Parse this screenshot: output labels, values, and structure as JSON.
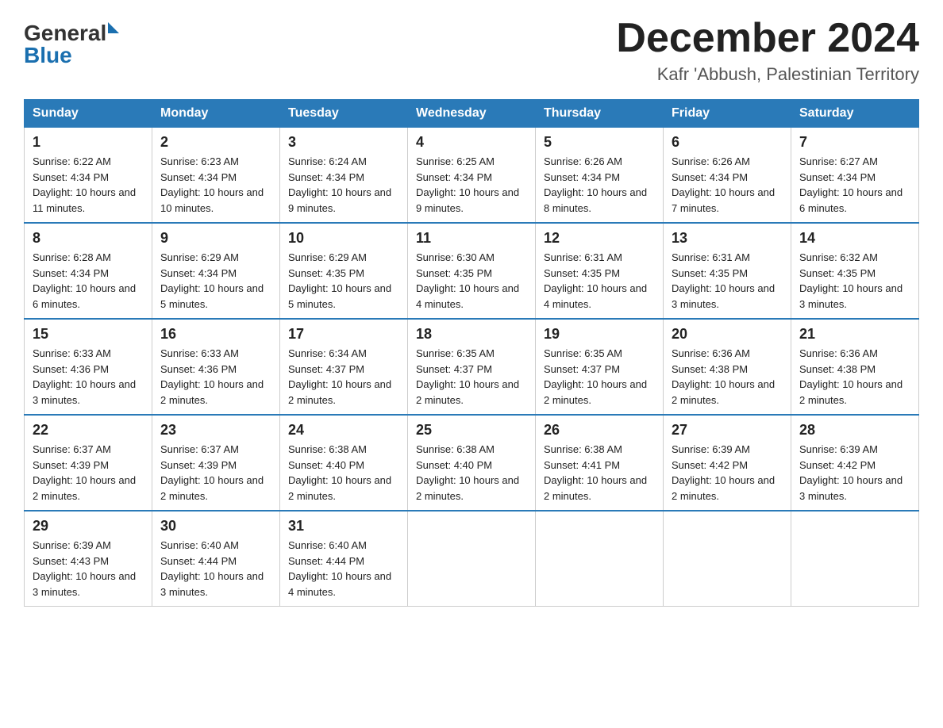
{
  "header": {
    "logo_general": "General",
    "logo_blue": "Blue",
    "month_title": "December 2024",
    "location": "Kafr 'Abbush, Palestinian Territory"
  },
  "days_of_week": [
    "Sunday",
    "Monday",
    "Tuesday",
    "Wednesday",
    "Thursday",
    "Friday",
    "Saturday"
  ],
  "weeks": [
    [
      {
        "day": "1",
        "sunrise": "6:22 AM",
        "sunset": "4:34 PM",
        "daylight": "10 hours and 11 minutes."
      },
      {
        "day": "2",
        "sunrise": "6:23 AM",
        "sunset": "4:34 PM",
        "daylight": "10 hours and 10 minutes."
      },
      {
        "day": "3",
        "sunrise": "6:24 AM",
        "sunset": "4:34 PM",
        "daylight": "10 hours and 9 minutes."
      },
      {
        "day": "4",
        "sunrise": "6:25 AM",
        "sunset": "4:34 PM",
        "daylight": "10 hours and 9 minutes."
      },
      {
        "day": "5",
        "sunrise": "6:26 AM",
        "sunset": "4:34 PM",
        "daylight": "10 hours and 8 minutes."
      },
      {
        "day": "6",
        "sunrise": "6:26 AM",
        "sunset": "4:34 PM",
        "daylight": "10 hours and 7 minutes."
      },
      {
        "day": "7",
        "sunrise": "6:27 AM",
        "sunset": "4:34 PM",
        "daylight": "10 hours and 6 minutes."
      }
    ],
    [
      {
        "day": "8",
        "sunrise": "6:28 AM",
        "sunset": "4:34 PM",
        "daylight": "10 hours and 6 minutes."
      },
      {
        "day": "9",
        "sunrise": "6:29 AM",
        "sunset": "4:34 PM",
        "daylight": "10 hours and 5 minutes."
      },
      {
        "day": "10",
        "sunrise": "6:29 AM",
        "sunset": "4:35 PM",
        "daylight": "10 hours and 5 minutes."
      },
      {
        "day": "11",
        "sunrise": "6:30 AM",
        "sunset": "4:35 PM",
        "daylight": "10 hours and 4 minutes."
      },
      {
        "day": "12",
        "sunrise": "6:31 AM",
        "sunset": "4:35 PM",
        "daylight": "10 hours and 4 minutes."
      },
      {
        "day": "13",
        "sunrise": "6:31 AM",
        "sunset": "4:35 PM",
        "daylight": "10 hours and 3 minutes."
      },
      {
        "day": "14",
        "sunrise": "6:32 AM",
        "sunset": "4:35 PM",
        "daylight": "10 hours and 3 minutes."
      }
    ],
    [
      {
        "day": "15",
        "sunrise": "6:33 AM",
        "sunset": "4:36 PM",
        "daylight": "10 hours and 3 minutes."
      },
      {
        "day": "16",
        "sunrise": "6:33 AM",
        "sunset": "4:36 PM",
        "daylight": "10 hours and 2 minutes."
      },
      {
        "day": "17",
        "sunrise": "6:34 AM",
        "sunset": "4:37 PM",
        "daylight": "10 hours and 2 minutes."
      },
      {
        "day": "18",
        "sunrise": "6:35 AM",
        "sunset": "4:37 PM",
        "daylight": "10 hours and 2 minutes."
      },
      {
        "day": "19",
        "sunrise": "6:35 AM",
        "sunset": "4:37 PM",
        "daylight": "10 hours and 2 minutes."
      },
      {
        "day": "20",
        "sunrise": "6:36 AM",
        "sunset": "4:38 PM",
        "daylight": "10 hours and 2 minutes."
      },
      {
        "day": "21",
        "sunrise": "6:36 AM",
        "sunset": "4:38 PM",
        "daylight": "10 hours and 2 minutes."
      }
    ],
    [
      {
        "day": "22",
        "sunrise": "6:37 AM",
        "sunset": "4:39 PM",
        "daylight": "10 hours and 2 minutes."
      },
      {
        "day": "23",
        "sunrise": "6:37 AM",
        "sunset": "4:39 PM",
        "daylight": "10 hours and 2 minutes."
      },
      {
        "day": "24",
        "sunrise": "6:38 AM",
        "sunset": "4:40 PM",
        "daylight": "10 hours and 2 minutes."
      },
      {
        "day": "25",
        "sunrise": "6:38 AM",
        "sunset": "4:40 PM",
        "daylight": "10 hours and 2 minutes."
      },
      {
        "day": "26",
        "sunrise": "6:38 AM",
        "sunset": "4:41 PM",
        "daylight": "10 hours and 2 minutes."
      },
      {
        "day": "27",
        "sunrise": "6:39 AM",
        "sunset": "4:42 PM",
        "daylight": "10 hours and 2 minutes."
      },
      {
        "day": "28",
        "sunrise": "6:39 AM",
        "sunset": "4:42 PM",
        "daylight": "10 hours and 3 minutes."
      }
    ],
    [
      {
        "day": "29",
        "sunrise": "6:39 AM",
        "sunset": "4:43 PM",
        "daylight": "10 hours and 3 minutes."
      },
      {
        "day": "30",
        "sunrise": "6:40 AM",
        "sunset": "4:44 PM",
        "daylight": "10 hours and 3 minutes."
      },
      {
        "day": "31",
        "sunrise": "6:40 AM",
        "sunset": "4:44 PM",
        "daylight": "10 hours and 4 minutes."
      },
      null,
      null,
      null,
      null
    ]
  ]
}
